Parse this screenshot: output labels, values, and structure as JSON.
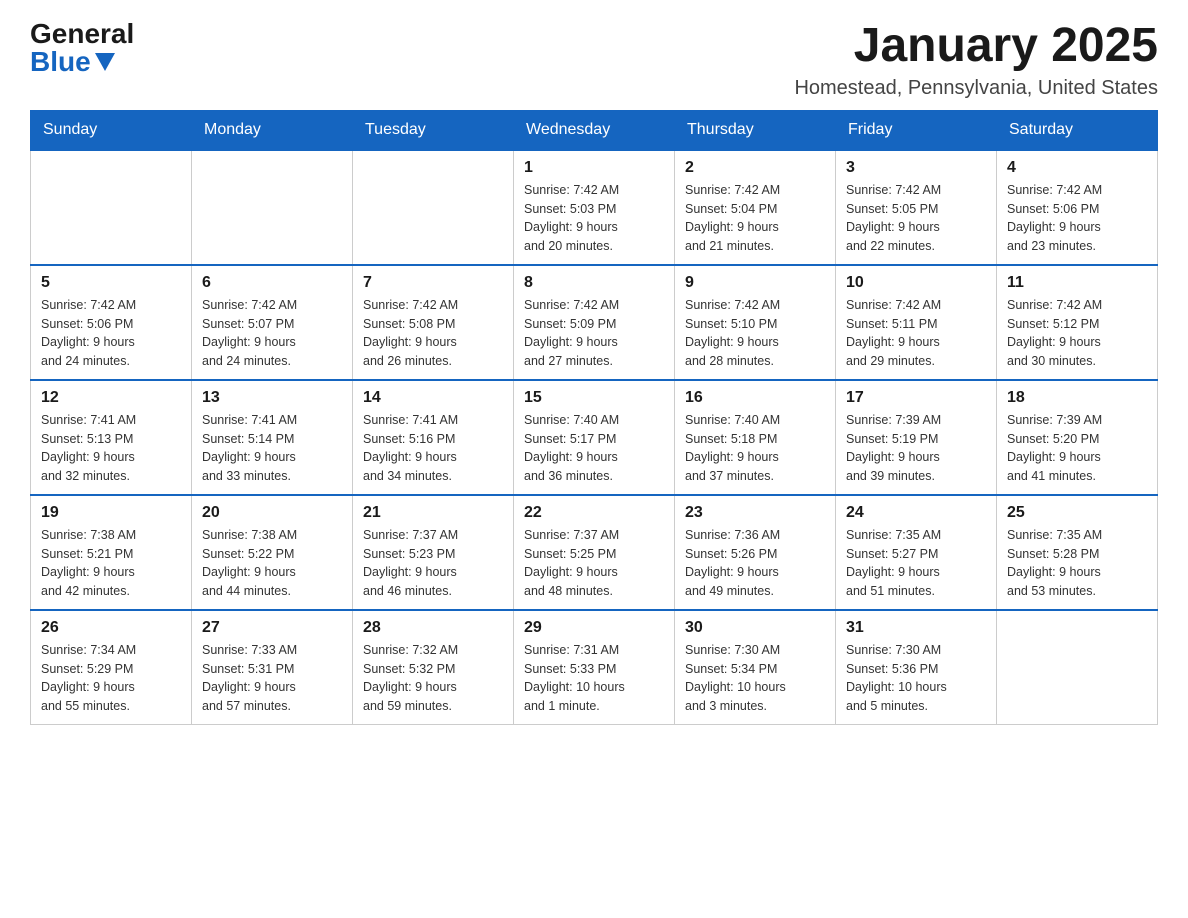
{
  "header": {
    "logo_general": "General",
    "logo_blue": "Blue",
    "month": "January 2025",
    "location": "Homestead, Pennsylvania, United States"
  },
  "weekdays": [
    "Sunday",
    "Monday",
    "Tuesday",
    "Wednesday",
    "Thursday",
    "Friday",
    "Saturday"
  ],
  "weeks": [
    [
      {
        "day": "",
        "info": ""
      },
      {
        "day": "",
        "info": ""
      },
      {
        "day": "",
        "info": ""
      },
      {
        "day": "1",
        "info": "Sunrise: 7:42 AM\nSunset: 5:03 PM\nDaylight: 9 hours\nand 20 minutes."
      },
      {
        "day": "2",
        "info": "Sunrise: 7:42 AM\nSunset: 5:04 PM\nDaylight: 9 hours\nand 21 minutes."
      },
      {
        "day": "3",
        "info": "Sunrise: 7:42 AM\nSunset: 5:05 PM\nDaylight: 9 hours\nand 22 minutes."
      },
      {
        "day": "4",
        "info": "Sunrise: 7:42 AM\nSunset: 5:06 PM\nDaylight: 9 hours\nand 23 minutes."
      }
    ],
    [
      {
        "day": "5",
        "info": "Sunrise: 7:42 AM\nSunset: 5:06 PM\nDaylight: 9 hours\nand 24 minutes."
      },
      {
        "day": "6",
        "info": "Sunrise: 7:42 AM\nSunset: 5:07 PM\nDaylight: 9 hours\nand 24 minutes."
      },
      {
        "day": "7",
        "info": "Sunrise: 7:42 AM\nSunset: 5:08 PM\nDaylight: 9 hours\nand 26 minutes."
      },
      {
        "day": "8",
        "info": "Sunrise: 7:42 AM\nSunset: 5:09 PM\nDaylight: 9 hours\nand 27 minutes."
      },
      {
        "day": "9",
        "info": "Sunrise: 7:42 AM\nSunset: 5:10 PM\nDaylight: 9 hours\nand 28 minutes."
      },
      {
        "day": "10",
        "info": "Sunrise: 7:42 AM\nSunset: 5:11 PM\nDaylight: 9 hours\nand 29 minutes."
      },
      {
        "day": "11",
        "info": "Sunrise: 7:42 AM\nSunset: 5:12 PM\nDaylight: 9 hours\nand 30 minutes."
      }
    ],
    [
      {
        "day": "12",
        "info": "Sunrise: 7:41 AM\nSunset: 5:13 PM\nDaylight: 9 hours\nand 32 minutes."
      },
      {
        "day": "13",
        "info": "Sunrise: 7:41 AM\nSunset: 5:14 PM\nDaylight: 9 hours\nand 33 minutes."
      },
      {
        "day": "14",
        "info": "Sunrise: 7:41 AM\nSunset: 5:16 PM\nDaylight: 9 hours\nand 34 minutes."
      },
      {
        "day": "15",
        "info": "Sunrise: 7:40 AM\nSunset: 5:17 PM\nDaylight: 9 hours\nand 36 minutes."
      },
      {
        "day": "16",
        "info": "Sunrise: 7:40 AM\nSunset: 5:18 PM\nDaylight: 9 hours\nand 37 minutes."
      },
      {
        "day": "17",
        "info": "Sunrise: 7:39 AM\nSunset: 5:19 PM\nDaylight: 9 hours\nand 39 minutes."
      },
      {
        "day": "18",
        "info": "Sunrise: 7:39 AM\nSunset: 5:20 PM\nDaylight: 9 hours\nand 41 minutes."
      }
    ],
    [
      {
        "day": "19",
        "info": "Sunrise: 7:38 AM\nSunset: 5:21 PM\nDaylight: 9 hours\nand 42 minutes."
      },
      {
        "day": "20",
        "info": "Sunrise: 7:38 AM\nSunset: 5:22 PM\nDaylight: 9 hours\nand 44 minutes."
      },
      {
        "day": "21",
        "info": "Sunrise: 7:37 AM\nSunset: 5:23 PM\nDaylight: 9 hours\nand 46 minutes."
      },
      {
        "day": "22",
        "info": "Sunrise: 7:37 AM\nSunset: 5:25 PM\nDaylight: 9 hours\nand 48 minutes."
      },
      {
        "day": "23",
        "info": "Sunrise: 7:36 AM\nSunset: 5:26 PM\nDaylight: 9 hours\nand 49 minutes."
      },
      {
        "day": "24",
        "info": "Sunrise: 7:35 AM\nSunset: 5:27 PM\nDaylight: 9 hours\nand 51 minutes."
      },
      {
        "day": "25",
        "info": "Sunrise: 7:35 AM\nSunset: 5:28 PM\nDaylight: 9 hours\nand 53 minutes."
      }
    ],
    [
      {
        "day": "26",
        "info": "Sunrise: 7:34 AM\nSunset: 5:29 PM\nDaylight: 9 hours\nand 55 minutes."
      },
      {
        "day": "27",
        "info": "Sunrise: 7:33 AM\nSunset: 5:31 PM\nDaylight: 9 hours\nand 57 minutes."
      },
      {
        "day": "28",
        "info": "Sunrise: 7:32 AM\nSunset: 5:32 PM\nDaylight: 9 hours\nand 59 minutes."
      },
      {
        "day": "29",
        "info": "Sunrise: 7:31 AM\nSunset: 5:33 PM\nDaylight: 10 hours\nand 1 minute."
      },
      {
        "day": "30",
        "info": "Sunrise: 7:30 AM\nSunset: 5:34 PM\nDaylight: 10 hours\nand 3 minutes."
      },
      {
        "day": "31",
        "info": "Sunrise: 7:30 AM\nSunset: 5:36 PM\nDaylight: 10 hours\nand 5 minutes."
      },
      {
        "day": "",
        "info": ""
      }
    ]
  ]
}
